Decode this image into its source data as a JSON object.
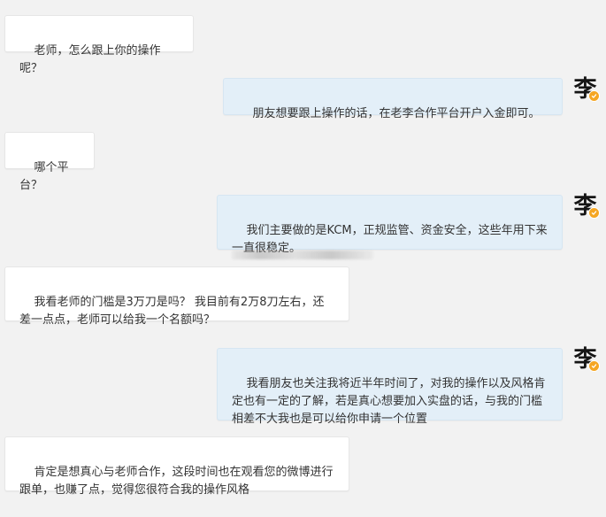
{
  "messages": [
    {
      "side": "left",
      "text": "老师，怎么跟上你的操作呢？"
    },
    {
      "side": "right",
      "text": "朋友想要跟上操作的话，在老李合作平台开户入金即可。",
      "avatar": {
        "char": "李",
        "icon": "verified-badge-icon"
      }
    },
    {
      "side": "left",
      "text": "哪个平台？"
    },
    {
      "side": "right",
      "text": "我们主要做的是KCM，正规监管、资金安全，这些年用下来一直很稳定。",
      "avatar": {
        "char": "李",
        "icon": "verified-badge-icon"
      }
    },
    {
      "side": "left",
      "text": "我看老师的门槛是3万刀是吗？ 我目前有2万8刀左右，还差一点点，老师可以给我一个名额吗？"
    },
    {
      "side": "right",
      "text": "我看朋友也关注我将近半年时间了，对我的操作以及风格肯定也有一定的了解，若是真心想要加入实盘的话，与我的门槛相差不大我也是可以给你申请一个位置",
      "avatar": {
        "char": "李",
        "icon": "verified-badge-icon"
      }
    },
    {
      "side": "left",
      "text": "肯定是想真心与老师合作，这段时间也在观看您的微博进行跟单，也赚了点，觉得您很符合我的操作风格"
    }
  ],
  "colors": {
    "background": "#f2f2f2",
    "left_bubble": "#ffffff",
    "right_bubble": "#e3eff8",
    "badge": "#f5a623",
    "text": "#333333"
  }
}
